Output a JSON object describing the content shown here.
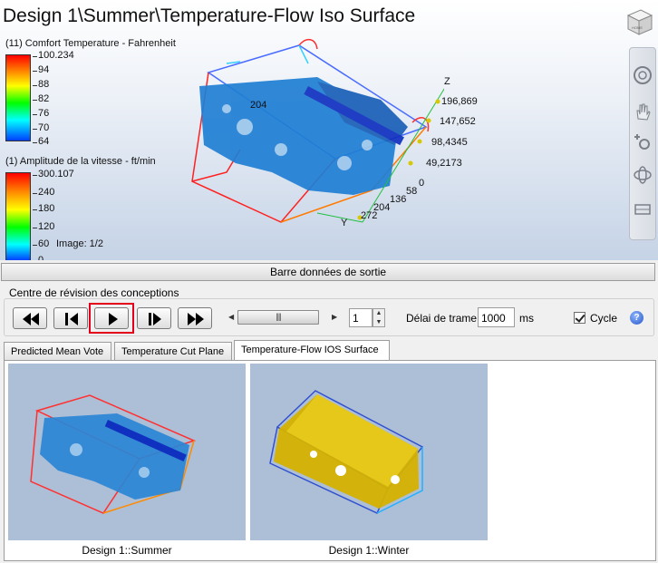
{
  "viewport": {
    "title": "Design 1\\Summer\\Temperature-Flow Iso Surface",
    "legend_temp": {
      "title": "(11) Comfort Temperature - Fahrenheit",
      "ticks": [
        "100.234",
        "94",
        "88",
        "82",
        "76",
        "70",
        "64"
      ]
    },
    "legend_velocity": {
      "title": "(1) Amplitude de la vitesse - ft/min",
      "ticks": [
        "300.107",
        "240",
        "180",
        "120",
        "60",
        "0"
      ],
      "image_counter": "Image: 1/2"
    },
    "axis_labels": {
      "z": "Z",
      "y": "Y",
      "v1": "196,869",
      "v2": "147,652",
      "v3": "98,4345",
      "v4": "49,2173",
      "v5": "0",
      "b1": "58",
      "b2": "136",
      "b3": "204",
      "b4": "272",
      "n1": "204"
    },
    "viewcube_label": "HOME"
  },
  "output_bar": {
    "label": "Barre données de sortie"
  },
  "review": {
    "group_label": "Centre de révision des conceptions",
    "frame_value": "1",
    "delay_label": "Délai de trame:",
    "delay_value": "1000",
    "delay_unit": "ms",
    "cycle_label": "Cycle",
    "cycle_checked": true,
    "help_glyph": "?"
  },
  "tabs": [
    {
      "label": "Predicted Mean Vote",
      "active": false
    },
    {
      "label": "Temperature Cut Plane",
      "active": false
    },
    {
      "label": "Temperature-Flow IOS Surface",
      "active": true
    }
  ],
  "thumbnails": [
    {
      "caption": "Design 1::Summer",
      "color": "#2a86d6"
    },
    {
      "caption": "Design 1::Winter",
      "color": "#d4b100"
    }
  ],
  "colors": {
    "accent_highlight": "#e2001a",
    "iso_summer": "#2a86d6",
    "iso_winter": "#d4b100"
  }
}
